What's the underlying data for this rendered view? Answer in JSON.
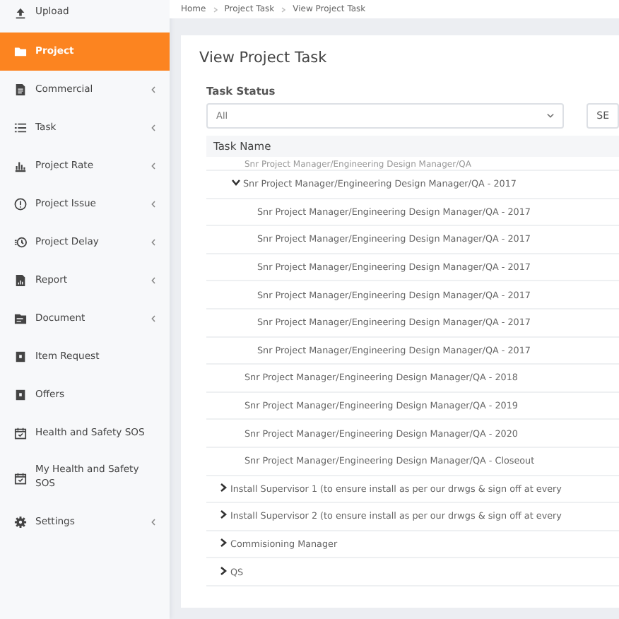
{
  "sidebar": {
    "items": [
      {
        "label": "Upload",
        "selected": false,
        "submenu": false
      },
      {
        "label": "Project",
        "selected": true,
        "submenu": false
      },
      {
        "label": "Commercial",
        "selected": false,
        "submenu": true
      },
      {
        "label": "Task",
        "selected": false,
        "submenu": true
      },
      {
        "label": "Project Rate",
        "selected": false,
        "submenu": true
      },
      {
        "label": "Project Issue",
        "selected": false,
        "submenu": true
      },
      {
        "label": "Project Delay",
        "selected": false,
        "submenu": true
      },
      {
        "label": "Report",
        "selected": false,
        "submenu": true
      },
      {
        "label": "Document",
        "selected": false,
        "submenu": true
      },
      {
        "label": "Item Request",
        "selected": false,
        "submenu": false
      },
      {
        "label": "Offers",
        "selected": false,
        "submenu": false
      },
      {
        "label": "Health and Safety SOS",
        "selected": false,
        "submenu": false
      },
      {
        "label": "My Health and Safety SOS",
        "selected": false,
        "submenu": false
      },
      {
        "label": "Settings",
        "selected": false,
        "submenu": true
      }
    ]
  },
  "breadcrumb": [
    "Home",
    "Project Task",
    "View Project Task"
  ],
  "page_title": "View Project Task",
  "filter": {
    "label": "Task Status",
    "value": "All",
    "button": "SE"
  },
  "table": {
    "column": "Task Name",
    "tree": [
      {
        "children": [
          {
            "label": "Snr Project Manager/Engineering Design Manager/QA"
          },
          {
            "label": "Snr Project Manager/Engineering Design Manager/QA - 2017",
            "expanded": true,
            "children": [
              {
                "label": "Snr Project Manager/Engineering Design Manager/QA - 2017"
              },
              {
                "label": "Snr Project Manager/Engineering Design Manager/QA - 2017"
              },
              {
                "label": "Snr Project Manager/Engineering Design Manager/QA - 2017"
              },
              {
                "label": "Snr Project Manager/Engineering Design Manager/QA - 2017"
              },
              {
                "label": "Snr Project Manager/Engineering Design Manager/QA - 2017"
              },
              {
                "label": "Snr Project Manager/Engineering Design Manager/QA - 2017"
              }
            ]
          },
          {
            "label": "Snr Project Manager/Engineering Design Manager/QA - 2018"
          },
          {
            "label": "Snr Project Manager/Engineering Design Manager/QA - 2019"
          },
          {
            "label": "Snr Project Manager/Engineering Design Manager/QA - 2020"
          },
          {
            "label": "Snr Project Manager/Engineering Design Manager/QA - Closeout"
          }
        ]
      },
      {
        "label": "Install Supervisor 1 (to ensure install as per our drwgs & sign off at every",
        "expanded": false
      },
      {
        "label": "Install Supervisor 2 (to ensure install as per our drwgs & sign off at every",
        "expanded": false
      },
      {
        "label": "Commisioning Manager",
        "expanded": false
      },
      {
        "label": "QS",
        "expanded": false
      }
    ]
  }
}
